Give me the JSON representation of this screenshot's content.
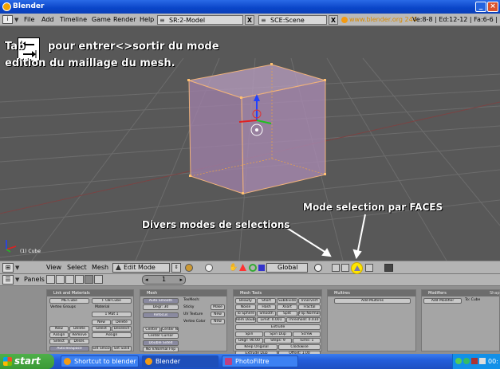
{
  "window": {
    "title": "Blender"
  },
  "header": {
    "menus": [
      "File",
      "Add",
      "Timeline",
      "Game",
      "Render",
      "Help"
    ],
    "screen": {
      "prefix": "SR:",
      "value": "2-Model"
    },
    "scene": {
      "prefix": "SCE:",
      "value": "Scene"
    },
    "close_x": "X",
    "url": "www.blender.org 244",
    "stats": "Ve:8-8 | Ed:12-12 | Fa:6-6 | Me"
  },
  "viewport": {
    "annotation_line1": "Tab",
    "annotation_line1b": "pour entrer<>sortir du mode",
    "annotation_line2": "edition du maillage du mesh.",
    "callout_faces": "Mode selection par FACES",
    "callout_modes": "Divers modes de selections",
    "object_label": "(1) Cube"
  },
  "view3d_header": {
    "menus": [
      "View",
      "Select",
      "Mesh"
    ],
    "mode": "Edit Mode",
    "orientation": "Global"
  },
  "buttons_header": {
    "panels_label": "Panels",
    "frame": "1"
  },
  "panels": {
    "link_materials": {
      "title": "Link and Materials",
      "me_name": "ME:Cube",
      "ob_name": "F OB:Cube",
      "vgroups": "Vertex Groups",
      "material": "Material",
      "mat_index": "1 Mat 1",
      "btn_new": "New",
      "btn_delete": "Delete",
      "btn_assign": "Assign",
      "btn_remove": "Remove",
      "btn_select": "Select",
      "btn_deselect": "Deselect",
      "btn_desel": "Desel.",
      "autotex": "AutoTexSpace",
      "set_smooth": "Set Smooth",
      "set_solid": "Set Solid"
    },
    "mesh": {
      "title": "Mesh",
      "auto_smooth": "Auto Smooth",
      "degr": "Degr: 30",
      "texmesh": "TexMesh:",
      "sticky": "Sticky",
      "make": "Make",
      "refocus": "Refocus",
      "uv_texture": "UV Texture",
      "new1": "New",
      "vertex_color": "Vertex Color",
      "new2": "New",
      "center_new": "Center New",
      "center": "Center",
      "center_cursor": "Center Cursor",
      "double_sided": "Double Sided",
      "no_vnormal_flip": "No V.Normal Flip"
    },
    "mesh_tools": {
      "title": "Mesh Tools",
      "beauty": "Beauty",
      "short": "Short",
      "subdivide": "Subdivide",
      "innervert": "Innervert",
      "noise": "Noise",
      "hash": "Hash",
      "xsort": "Xsort",
      "fractal": "Fractal",
      "to_sphere": "To Sphere",
      "smooth": "Smooth",
      "split": "Split",
      "flip_normals": "Flip Normals",
      "rem_doubles": "Rem Doubles",
      "limit": "Limit: 0.001",
      "threshold": "Threshold: 0.010",
      "extrude": "Extrude",
      "spin": "Spin",
      "spin_dup": "Spin Dup",
      "screw": "Screw",
      "degr": "Degr: 90.00",
      "steps": "Steps: 9",
      "turns": "Turns: 1",
      "keep_original": "Keep Original",
      "clockwise": "Clockwise",
      "extrude_dup": "Extrude Dup",
      "offset": "Offset: 1.00"
    },
    "multires": {
      "title": "Multires",
      "add": "Add Multires"
    },
    "modifiers": {
      "title": "Modifiers",
      "tab2": "Shapes",
      "add": "Add Modifier",
      "to": "To: Cube"
    }
  },
  "taskbar": {
    "start": "start",
    "tasks": [
      "Shortcut to blender",
      "Blender",
      "PhotoFiltre"
    ],
    "clock": "00:"
  },
  "colors": {
    "viewport_bg": "#585858",
    "cube_face": "#9d7fa6",
    "cube_edge": "#f0b27a",
    "taskbar": "#245edb",
    "start": "#3a9a35",
    "highlight": "#ffe600"
  }
}
